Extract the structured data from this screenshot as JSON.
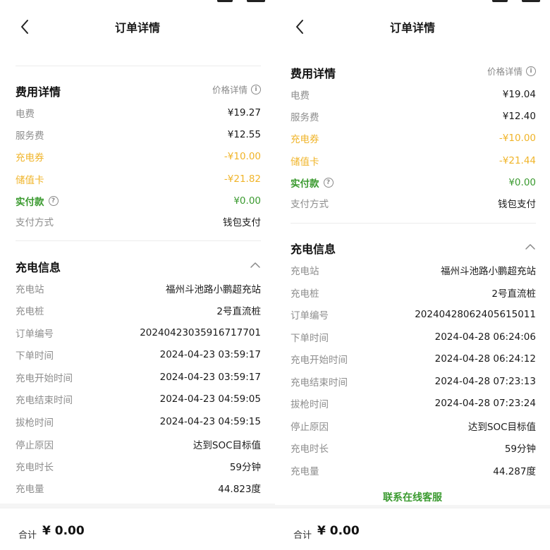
{
  "screens": [
    {
      "nav": {
        "title": "订单详情"
      },
      "fee": {
        "title": "费用详情",
        "aside": "价格详情",
        "rows": [
          {
            "label": "电费",
            "value": "¥19.27"
          },
          {
            "label": "服务费",
            "value": "¥12.55"
          },
          {
            "label": "充电券",
            "value": "-¥10.00"
          },
          {
            "label": "储值卡",
            "value": "-¥21.82"
          },
          {
            "label": "实付款",
            "value": "¥0.00"
          },
          {
            "label": "支付方式",
            "value": "钱包支付"
          }
        ]
      },
      "charge": {
        "title": "充电信息",
        "rows": [
          {
            "label": "充电站",
            "value": "福州斗池路小鹏超充站"
          },
          {
            "label": "充电桩",
            "value": "2号直流桩"
          },
          {
            "label": "订单编号",
            "value": "20240423035916717701"
          },
          {
            "label": "下单时间",
            "value": "2024-04-23 03:59:17"
          },
          {
            "label": "充电开始时间",
            "value": "2024-04-23 03:59:17"
          },
          {
            "label": "充电结束时间",
            "value": "2024-04-23 04:59:05"
          },
          {
            "label": "拔枪时间",
            "value": "2024-04-23 04:59:15"
          },
          {
            "label": "停止原因",
            "value": "达到SOC目标值"
          },
          {
            "label": "充电时长",
            "value": "59分钟"
          },
          {
            "label": "充电量",
            "value": "44.823度"
          }
        ]
      },
      "bottom": {
        "total_label": "合计",
        "total_value": "¥ 0.00"
      }
    },
    {
      "nav": {
        "title": "订单详情"
      },
      "fee": {
        "title": "费用详情",
        "aside": "价格详情",
        "rows": [
          {
            "label": "电费",
            "value": "¥19.04"
          },
          {
            "label": "服务费",
            "value": "¥12.40"
          },
          {
            "label": "充电券",
            "value": "-¥10.00"
          },
          {
            "label": "储值卡",
            "value": "-¥21.44"
          },
          {
            "label": "实付款",
            "value": "¥0.00"
          },
          {
            "label": "支付方式",
            "value": "钱包支付"
          }
        ]
      },
      "charge": {
        "title": "充电信息",
        "rows": [
          {
            "label": "充电站",
            "value": "福州斗池路小鹏超充站"
          },
          {
            "label": "充电桩",
            "value": "2号直流桩"
          },
          {
            "label": "订单编号",
            "value": "20240428062405615011"
          },
          {
            "label": "下单时间",
            "value": "2024-04-28 06:24:06"
          },
          {
            "label": "充电开始时间",
            "value": "2024-04-28 06:24:12"
          },
          {
            "label": "充电结束时间",
            "value": "2024-04-28 07:23:13"
          },
          {
            "label": "拔枪时间",
            "value": "2024-04-28 07:23:24"
          },
          {
            "label": "停止原因",
            "value": "达到SOC目标值"
          },
          {
            "label": "充电时长",
            "value": "59分钟"
          },
          {
            "label": "充电量",
            "value": "44.287度"
          }
        ]
      },
      "service_link": "联系在线客服",
      "bottom": {
        "total_label": "合计",
        "total_value": "¥ 0.00"
      }
    }
  ],
  "colors": {
    "accent_green": "#3a9a2f",
    "discount_orange": "#f0b429",
    "label_gray": "#8d8d8d"
  },
  "icons": {
    "back": "chevron-left-icon",
    "info": "info-icon",
    "question": "question-icon",
    "collapse": "chevron-up-icon"
  }
}
